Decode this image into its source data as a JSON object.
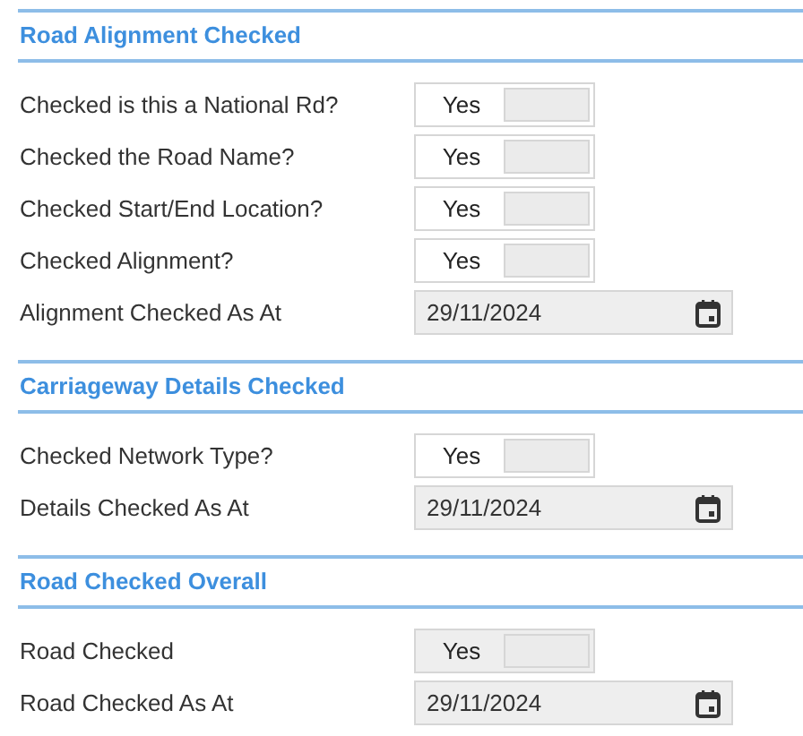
{
  "sections": [
    {
      "title": "Road Alignment Checked",
      "rows": [
        {
          "kind": "toggle",
          "label": "Checked is this a National Rd?",
          "text": "Yes",
          "on": true,
          "disabled": false
        },
        {
          "kind": "toggle",
          "label": "Checked the Road Name?",
          "text": "Yes",
          "on": true,
          "disabled": false
        },
        {
          "kind": "toggle",
          "label": "Checked Start/End Location?",
          "text": "Yes",
          "on": true,
          "disabled": false
        },
        {
          "kind": "toggle",
          "label": "Checked Alignment?",
          "text": "Yes",
          "on": true,
          "disabled": false
        },
        {
          "kind": "date",
          "label": "Alignment Checked As At",
          "value": "29/11/2024"
        }
      ]
    },
    {
      "title": "Carriageway Details Checked",
      "rows": [
        {
          "kind": "toggle",
          "label": "Checked Network Type?",
          "text": "Yes",
          "on": true,
          "disabled": false
        },
        {
          "kind": "date",
          "label": "Details Checked As At",
          "value": "29/11/2024"
        }
      ]
    },
    {
      "title": "Road Checked Overall",
      "rows": [
        {
          "kind": "toggle",
          "label": "Road Checked",
          "text": "Yes",
          "on": true,
          "disabled": true
        },
        {
          "kind": "date",
          "label": "Road Checked As At",
          "value": "29/11/2024"
        }
      ]
    }
  ]
}
